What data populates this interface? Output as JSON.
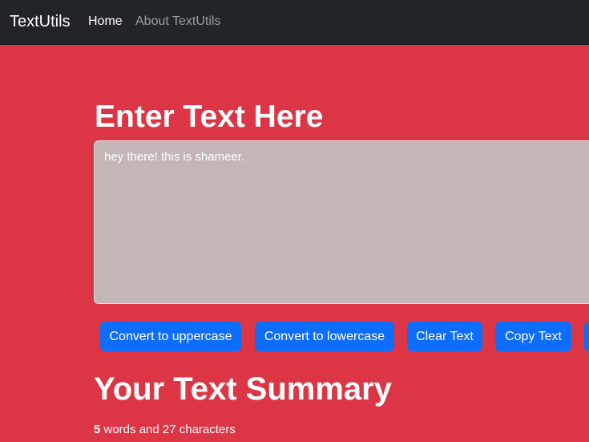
{
  "navbar": {
    "brand": "TextUtils",
    "links": [
      "Home",
      "About TextUtils"
    ]
  },
  "main": {
    "heading": "Enter Text Here",
    "textarea_value": "hey there! this is shameer.",
    "buttons": [
      "Convert to uppercase",
      "Convert to lowercase",
      "Clear Text",
      "Copy Text",
      ""
    ],
    "summary_heading": "Your Text Summary",
    "summary": {
      "word_count": "5",
      "rest": " words and 27 characters"
    }
  },
  "colors": {
    "background": "#dc3545",
    "navbar": "#212529",
    "button": "#0d6efd",
    "textarea": "#c4b6b6"
  }
}
